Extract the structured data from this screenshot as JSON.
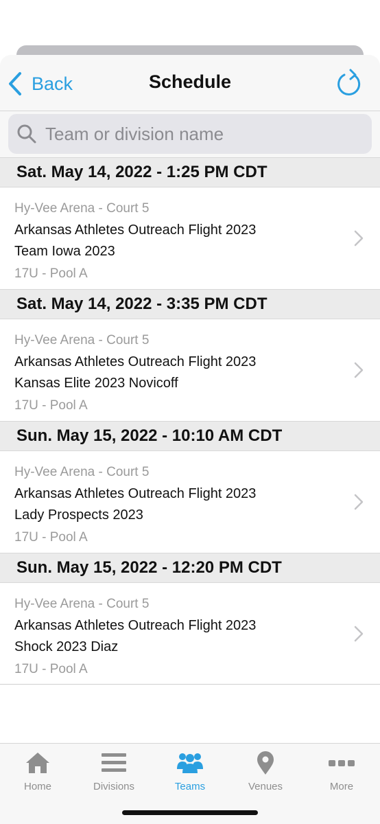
{
  "colors": {
    "accent": "#2a9fe0",
    "inactive": "#8e8e8e",
    "header_bg": "#ebebeb"
  },
  "navbar": {
    "back_label": "Back",
    "title": "Schedule"
  },
  "search": {
    "placeholder": "Team or division name"
  },
  "schedule": [
    {
      "date": "Sat. May 14, 2022 - 1:25 PM CDT",
      "venue": "Hy-Vee Arena - Court 5",
      "team1": "Arkansas Athletes Outreach Flight 2023",
      "team2": "Team Iowa 2023",
      "division": "17U - Pool A"
    },
    {
      "date": "Sat. May 14, 2022 - 3:35 PM CDT",
      "venue": "Hy-Vee Arena - Court 5",
      "team1": "Arkansas Athletes Outreach Flight 2023",
      "team2": "Kansas Elite 2023 Novicoff",
      "division": "17U - Pool A"
    },
    {
      "date": "Sun. May 15, 2022 - 10:10 AM CDT",
      "venue": "Hy-Vee Arena - Court 5",
      "team1": "Arkansas Athletes Outreach Flight 2023",
      "team2": "Lady Prospects 2023",
      "division": "17U - Pool A"
    },
    {
      "date": "Sun. May 15, 2022 - 12:20 PM CDT",
      "venue": "Hy-Vee Arena - Court 5",
      "team1": "Arkansas Athletes Outreach Flight 2023",
      "team2": "Shock 2023 Diaz",
      "division": "17U - Pool A"
    }
  ],
  "tabbar": {
    "active": "Teams",
    "items": [
      {
        "label": "Home",
        "icon": "home-icon"
      },
      {
        "label": "Divisions",
        "icon": "list-icon"
      },
      {
        "label": "Teams",
        "icon": "team-icon"
      },
      {
        "label": "Venues",
        "icon": "map-pin-icon"
      },
      {
        "label": "More",
        "icon": "more-icon"
      }
    ]
  }
}
